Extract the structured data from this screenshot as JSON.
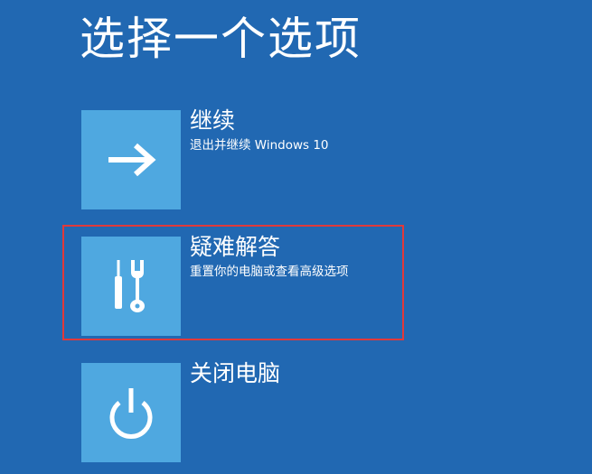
{
  "page": {
    "title": "选择一个选项"
  },
  "options": [
    {
      "id": "continue",
      "title": "继续",
      "description": "退出并继续 Windows 10",
      "icon": "arrow-right-icon"
    },
    {
      "id": "troubleshoot",
      "title": "疑难解答",
      "description": "重置你的电脑或查看高级选项",
      "icon": "tools-icon"
    },
    {
      "id": "shutdown",
      "title": "关闭电脑",
      "description": "",
      "icon": "power-icon"
    }
  ],
  "colors": {
    "background": "#2168b2",
    "tile": "#4fa8e0",
    "text": "#ffffff",
    "highlight_border": "#e0393b"
  }
}
